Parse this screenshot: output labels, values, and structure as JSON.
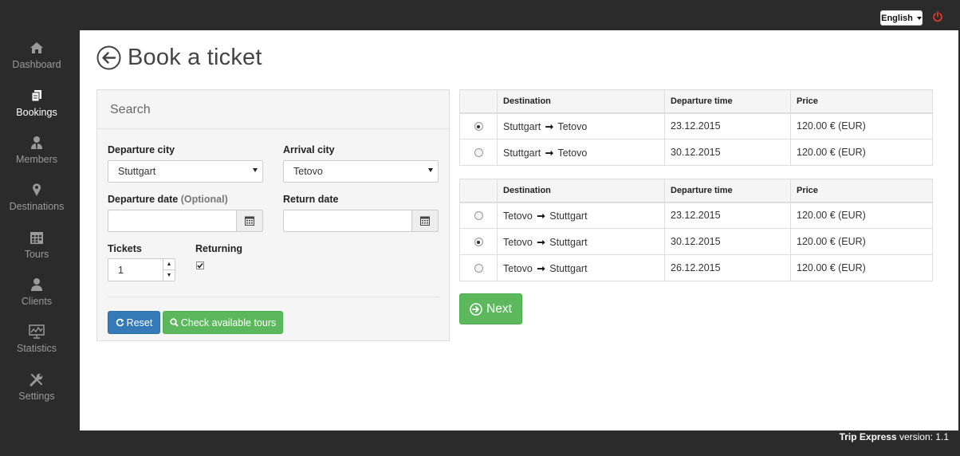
{
  "topbar": {
    "language": "English",
    "language_caret": "caret-down-icon",
    "power_icon": "power-icon"
  },
  "sidebar": {
    "items": [
      {
        "label": "Dashboard",
        "icon": "home-icon",
        "active": false
      },
      {
        "label": "Bookings",
        "icon": "documents-icon",
        "active": true
      },
      {
        "label": "Members",
        "icon": "user-tie-icon",
        "active": false
      },
      {
        "label": "Destinations",
        "icon": "map-marker-icon",
        "active": false
      },
      {
        "label": "Tours",
        "icon": "calendar-icon",
        "active": false
      },
      {
        "label": "Clients",
        "icon": "user-icon",
        "active": false
      },
      {
        "label": "Statistics",
        "icon": "chart-monitor-icon",
        "active": false
      },
      {
        "label": "Settings",
        "icon": "wrench-icon",
        "active": false
      }
    ]
  },
  "page": {
    "title": "Book a ticket"
  },
  "search": {
    "heading": "Search",
    "departure_city_label": "Departure city",
    "departure_city_value": "Stuttgart",
    "arrival_city_label": "Arrival city",
    "arrival_city_value": "Tetovo",
    "departure_date_label": "Departure date",
    "departure_date_optional": "(Optional)",
    "return_date_label": "Return date",
    "tickets_label": "Tickets",
    "tickets_value": "1",
    "returning_label": "Returning",
    "returning_checked": true,
    "reset_label": "Reset",
    "check_label": "Check available tours"
  },
  "outbound": {
    "headers": [
      "",
      "Destination",
      "Departure time",
      "Price"
    ],
    "rows": [
      {
        "selected": true,
        "from": "Stuttgart",
        "to": "Tetovo",
        "time": "23.12.2015",
        "price": "120.00 € (EUR)"
      },
      {
        "selected": false,
        "from": "Stuttgart",
        "to": "Tetovo",
        "time": "30.12.2015",
        "price": "120.00 € (EUR)"
      }
    ]
  },
  "return": {
    "headers": [
      "",
      "Destination",
      "Departure time",
      "Price"
    ],
    "rows": [
      {
        "selected": false,
        "from": "Tetovo",
        "to": "Stuttgart",
        "time": "23.12.2015",
        "price": "120.00 € (EUR)"
      },
      {
        "selected": true,
        "from": "Tetovo",
        "to": "Stuttgart",
        "time": "30.12.2015",
        "price": "120.00 € (EUR)"
      },
      {
        "selected": false,
        "from": "Tetovo",
        "to": "Stuttgart",
        "time": "26.12.2015",
        "price": "120.00 € (EUR)"
      }
    ]
  },
  "next_label": "Next",
  "footer": {
    "brand": "Trip Express",
    "version_text": "version: 1.1"
  },
  "colors": {
    "sidebar_bg": "#2b2b2b",
    "primary": "#337ab7",
    "success": "#5cb85c",
    "power": "#e0362c"
  }
}
